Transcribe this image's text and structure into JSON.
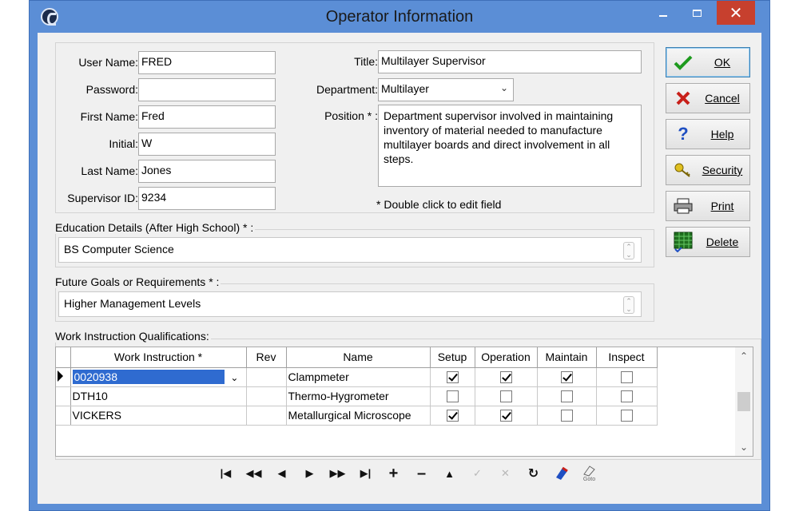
{
  "window": {
    "title": "Operator Information"
  },
  "colors": {
    "titlebar": "#5b8ed6",
    "close_button": "#c7402e",
    "selection": "#2f6bd0"
  },
  "operator": {
    "user_name_label": "User Name:",
    "user_name": "FRED",
    "password_label": "Password:",
    "password": "",
    "first_name_label": "First Name:",
    "first_name": "Fred",
    "initial_label": "Initial:",
    "initial": "W",
    "last_name_label": "Last Name:",
    "last_name": "Jones",
    "supervisor_id_label": "Supervisor ID:",
    "supervisor_id": "9234",
    "title_label": "Title:",
    "title": "Multilayer Supervisor",
    "department_label": "Department:",
    "department": "Multilayer",
    "position_label": "Position * :",
    "position": "Department supervisor involved in maintaining inventory of material needed to manufacture multilayer boards and direct involvement in all steps.",
    "note": "* Double click to edit field"
  },
  "education": {
    "label": "Education Details (After High School) * :",
    "value": "BS Computer Science"
  },
  "goals": {
    "label": "Future Goals or Requirements * :",
    "value": "Higher Management Levels"
  },
  "buttons": {
    "ok": "OK",
    "cancel": "Cancel",
    "help": "Help",
    "security": "Security",
    "print": "Print",
    "delete": "Delete"
  },
  "qualifications": {
    "label": "Work Instruction Qualifications:",
    "columns": [
      "Work Instruction *",
      "Rev",
      "Name",
      "Setup",
      "Operation",
      "Maintain",
      "Inspect"
    ],
    "rows": [
      {
        "instruction": "0020938",
        "rev": "",
        "name": "Clampmeter",
        "setup": true,
        "operation": true,
        "maintain": true,
        "inspect": false
      },
      {
        "instruction": "DTH10",
        "rev": "",
        "name": "Thermo-Hygrometer",
        "setup": false,
        "operation": false,
        "maintain": false,
        "inspect": false
      },
      {
        "instruction": "VICKERS",
        "rev": "",
        "name": "Metallurgical Microscope",
        "setup": true,
        "operation": true,
        "maintain": false,
        "inspect": false
      }
    ]
  },
  "navigator": {
    "goto_label": "Goto"
  }
}
